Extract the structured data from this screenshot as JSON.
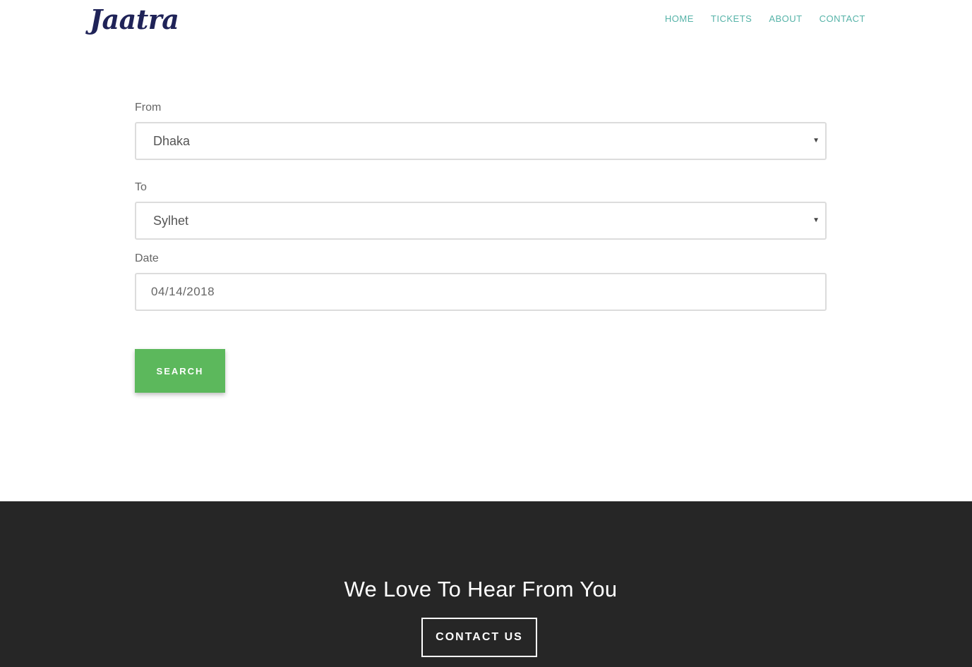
{
  "header": {
    "logo": "Jaatra",
    "nav": [
      "HOME",
      "TICKETS",
      "ABOUT",
      "CONTACT"
    ]
  },
  "form": {
    "from": {
      "label": "From",
      "value": "Dhaka"
    },
    "to": {
      "label": "To",
      "value": "Sylhet"
    },
    "date": {
      "label": "Date",
      "value": "04/14/2018"
    },
    "search_label": "SEARCH"
  },
  "footer": {
    "title": "We Love To Hear From You",
    "contact_label": "CONTACT US"
  },
  "colors": {
    "logo": "#1f2358",
    "nav": "#56b3a8",
    "search_button": "#5cb85c",
    "footer_bg": "#262626"
  }
}
